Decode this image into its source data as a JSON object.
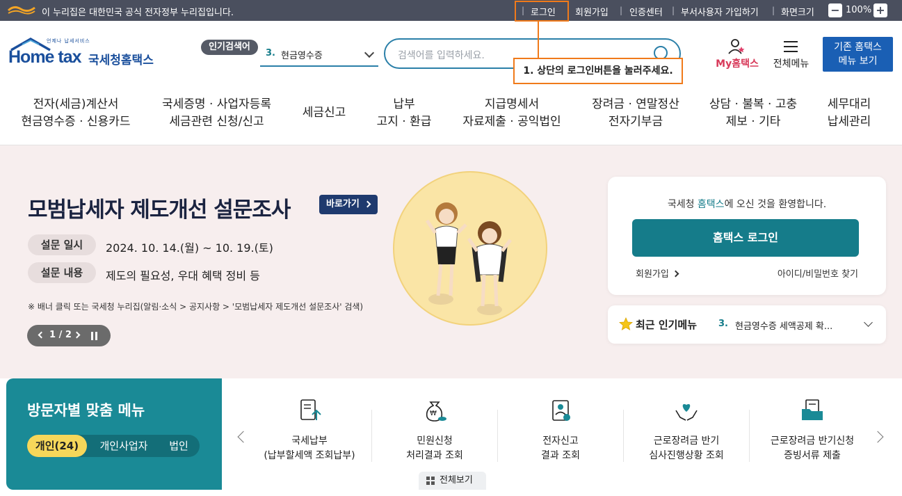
{
  "gov_bar": {
    "notice": "이 누리집은 대한민국 공식 전자정부 누리집입니다.",
    "links": [
      "로그인",
      "회원가입",
      "인증센터",
      "부서사용자 가입하기",
      "화면크기"
    ],
    "zoom_value": "100%",
    "zoom_out": "−",
    "zoom_in": "+"
  },
  "header": {
    "logo_sub": "언제나 납세서비스",
    "logo_en": "Home tax",
    "logo_kr": "국세청홈택스",
    "popular_badge": "인기검색어",
    "popular_num": "3.",
    "popular_text": "현금영수증",
    "search_placeholder": "검색어를 입력하세요.",
    "myhome": "My홈택스",
    "allmenu": "전체메뉴",
    "old_menu_line1": "기존 홈택스",
    "old_menu_line2": "메뉴 보기"
  },
  "tooltip": "1. 상단의 로그인버튼을 눌러주세요.",
  "gnb": [
    {
      "line1": "전자(세금)계산서",
      "line2": "현금영수증 · 신용카드"
    },
    {
      "line1": "국세증명 · 사업자등록",
      "line2": "세금관련 신청/신고"
    },
    {
      "line1": "세금신고",
      "line2": ""
    },
    {
      "line1": "납부",
      "line2": "고지 · 환급"
    },
    {
      "line1": "지급명세서",
      "line2": "자료제출 · 공익법인"
    },
    {
      "line1": "장려금 · 연말정산",
      "line2": "전자기부금"
    },
    {
      "line1": "상담 · 불복 · 고충",
      "line2": "제보 · 기타"
    },
    {
      "line1": "세무대리",
      "line2": "납세관리"
    }
  ],
  "banner": {
    "title": "모범납세자 제도개선 설문조사",
    "go_button": "바로가기",
    "row1_label": "설문 일시",
    "row1_value": "2024. 10. 14.(월) ~ 10. 19.(토)",
    "row2_label": "설문 내용",
    "row2_value": "제도의 필요성, 우대 혜택 정비 등",
    "note": "※ 배너 클릭 또는 국세청 누리집(알림·소식 > 공지사항 > '모범납세자 제도개선 설문조사' 검색)",
    "pager": "1 / 2"
  },
  "login_card": {
    "welcome_pre": "국세청 ",
    "welcome_brand": "홈택스",
    "welcome_post": "에 오신 것을 환영합니다.",
    "login_button": "홈택스 로그인",
    "join": "회원가입",
    "find": "아이디/비밀번호 찾기"
  },
  "recent": {
    "label": "최근 인기메뉴",
    "num": "3.",
    "value": "현금영수증 세액공제 확..."
  },
  "visitor": {
    "title": "방문자별 맞춤 메뉴",
    "tabs": [
      "개인(24)",
      "개인사업자",
      "법인"
    ],
    "services": [
      {
        "line1": "국세납부",
        "line2": "(납부할세액 조회납부)",
        "icon": "tax-payment-icon"
      },
      {
        "line1": "민원신청",
        "line2": "처리결과 조회",
        "icon": "money-bag-icon"
      },
      {
        "line1": "전자신고",
        "line2": "결과 조회",
        "icon": "e-filing-icon"
      },
      {
        "line1": "근로장려금 반기",
        "line2": "심사진행상황 조회",
        "icon": "heart-hands-icon"
      },
      {
        "line1": "근로장려금 반기신청",
        "line2": "증빙서류 제출",
        "icon": "folder-document-icon"
      }
    ],
    "view_all": "전체보기"
  },
  "colors": {
    "teal": "#157c8a",
    "blue": "#1a5fb4",
    "orange_highlight": "#f07a1a",
    "gov_bar": "#4a4f5e",
    "banner_bg": "#f7eeee"
  }
}
